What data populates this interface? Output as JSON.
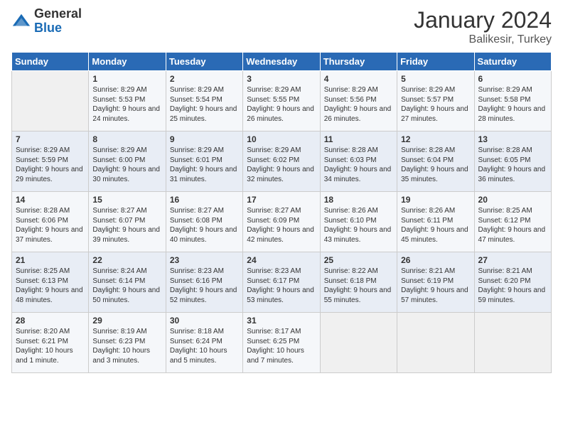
{
  "header": {
    "logo_general": "General",
    "logo_blue": "Blue",
    "month_title": "January 2024",
    "location": "Balikesir, Turkey"
  },
  "weekdays": [
    "Sunday",
    "Monday",
    "Tuesday",
    "Wednesday",
    "Thursday",
    "Friday",
    "Saturday"
  ],
  "weeks": [
    [
      {
        "day": "",
        "sunrise": "",
        "sunset": "",
        "daylight": ""
      },
      {
        "day": "1",
        "sunrise": "Sunrise: 8:29 AM",
        "sunset": "Sunset: 5:53 PM",
        "daylight": "Daylight: 9 hours and 24 minutes."
      },
      {
        "day": "2",
        "sunrise": "Sunrise: 8:29 AM",
        "sunset": "Sunset: 5:54 PM",
        "daylight": "Daylight: 9 hours and 25 minutes."
      },
      {
        "day": "3",
        "sunrise": "Sunrise: 8:29 AM",
        "sunset": "Sunset: 5:55 PM",
        "daylight": "Daylight: 9 hours and 26 minutes."
      },
      {
        "day": "4",
        "sunrise": "Sunrise: 8:29 AM",
        "sunset": "Sunset: 5:56 PM",
        "daylight": "Daylight: 9 hours and 26 minutes."
      },
      {
        "day": "5",
        "sunrise": "Sunrise: 8:29 AM",
        "sunset": "Sunset: 5:57 PM",
        "daylight": "Daylight: 9 hours and 27 minutes."
      },
      {
        "day": "6",
        "sunrise": "Sunrise: 8:29 AM",
        "sunset": "Sunset: 5:58 PM",
        "daylight": "Daylight: 9 hours and 28 minutes."
      }
    ],
    [
      {
        "day": "7",
        "sunrise": "Sunrise: 8:29 AM",
        "sunset": "Sunset: 5:59 PM",
        "daylight": "Daylight: 9 hours and 29 minutes."
      },
      {
        "day": "8",
        "sunrise": "Sunrise: 8:29 AM",
        "sunset": "Sunset: 6:00 PM",
        "daylight": "Daylight: 9 hours and 30 minutes."
      },
      {
        "day": "9",
        "sunrise": "Sunrise: 8:29 AM",
        "sunset": "Sunset: 6:01 PM",
        "daylight": "Daylight: 9 hours and 31 minutes."
      },
      {
        "day": "10",
        "sunrise": "Sunrise: 8:29 AM",
        "sunset": "Sunset: 6:02 PM",
        "daylight": "Daylight: 9 hours and 32 minutes."
      },
      {
        "day": "11",
        "sunrise": "Sunrise: 8:28 AM",
        "sunset": "Sunset: 6:03 PM",
        "daylight": "Daylight: 9 hours and 34 minutes."
      },
      {
        "day": "12",
        "sunrise": "Sunrise: 8:28 AM",
        "sunset": "Sunset: 6:04 PM",
        "daylight": "Daylight: 9 hours and 35 minutes."
      },
      {
        "day": "13",
        "sunrise": "Sunrise: 8:28 AM",
        "sunset": "Sunset: 6:05 PM",
        "daylight": "Daylight: 9 hours and 36 minutes."
      }
    ],
    [
      {
        "day": "14",
        "sunrise": "Sunrise: 8:28 AM",
        "sunset": "Sunset: 6:06 PM",
        "daylight": "Daylight: 9 hours and 37 minutes."
      },
      {
        "day": "15",
        "sunrise": "Sunrise: 8:27 AM",
        "sunset": "Sunset: 6:07 PM",
        "daylight": "Daylight: 9 hours and 39 minutes."
      },
      {
        "day": "16",
        "sunrise": "Sunrise: 8:27 AM",
        "sunset": "Sunset: 6:08 PM",
        "daylight": "Daylight: 9 hours and 40 minutes."
      },
      {
        "day": "17",
        "sunrise": "Sunrise: 8:27 AM",
        "sunset": "Sunset: 6:09 PM",
        "daylight": "Daylight: 9 hours and 42 minutes."
      },
      {
        "day": "18",
        "sunrise": "Sunrise: 8:26 AM",
        "sunset": "Sunset: 6:10 PM",
        "daylight": "Daylight: 9 hours and 43 minutes."
      },
      {
        "day": "19",
        "sunrise": "Sunrise: 8:26 AM",
        "sunset": "Sunset: 6:11 PM",
        "daylight": "Daylight: 9 hours and 45 minutes."
      },
      {
        "day": "20",
        "sunrise": "Sunrise: 8:25 AM",
        "sunset": "Sunset: 6:12 PM",
        "daylight": "Daylight: 9 hours and 47 minutes."
      }
    ],
    [
      {
        "day": "21",
        "sunrise": "Sunrise: 8:25 AM",
        "sunset": "Sunset: 6:13 PM",
        "daylight": "Daylight: 9 hours and 48 minutes."
      },
      {
        "day": "22",
        "sunrise": "Sunrise: 8:24 AM",
        "sunset": "Sunset: 6:14 PM",
        "daylight": "Daylight: 9 hours and 50 minutes."
      },
      {
        "day": "23",
        "sunrise": "Sunrise: 8:23 AM",
        "sunset": "Sunset: 6:16 PM",
        "daylight": "Daylight: 9 hours and 52 minutes."
      },
      {
        "day": "24",
        "sunrise": "Sunrise: 8:23 AM",
        "sunset": "Sunset: 6:17 PM",
        "daylight": "Daylight: 9 hours and 53 minutes."
      },
      {
        "day": "25",
        "sunrise": "Sunrise: 8:22 AM",
        "sunset": "Sunset: 6:18 PM",
        "daylight": "Daylight: 9 hours and 55 minutes."
      },
      {
        "day": "26",
        "sunrise": "Sunrise: 8:21 AM",
        "sunset": "Sunset: 6:19 PM",
        "daylight": "Daylight: 9 hours and 57 minutes."
      },
      {
        "day": "27",
        "sunrise": "Sunrise: 8:21 AM",
        "sunset": "Sunset: 6:20 PM",
        "daylight": "Daylight: 9 hours and 59 minutes."
      }
    ],
    [
      {
        "day": "28",
        "sunrise": "Sunrise: 8:20 AM",
        "sunset": "Sunset: 6:21 PM",
        "daylight": "Daylight: 10 hours and 1 minute."
      },
      {
        "day": "29",
        "sunrise": "Sunrise: 8:19 AM",
        "sunset": "Sunset: 6:23 PM",
        "daylight": "Daylight: 10 hours and 3 minutes."
      },
      {
        "day": "30",
        "sunrise": "Sunrise: 8:18 AM",
        "sunset": "Sunset: 6:24 PM",
        "daylight": "Daylight: 10 hours and 5 minutes."
      },
      {
        "day": "31",
        "sunrise": "Sunrise: 8:17 AM",
        "sunset": "Sunset: 6:25 PM",
        "daylight": "Daylight: 10 hours and 7 minutes."
      },
      {
        "day": "",
        "sunrise": "",
        "sunset": "",
        "daylight": ""
      },
      {
        "day": "",
        "sunrise": "",
        "sunset": "",
        "daylight": ""
      },
      {
        "day": "",
        "sunrise": "",
        "sunset": "",
        "daylight": ""
      }
    ]
  ]
}
